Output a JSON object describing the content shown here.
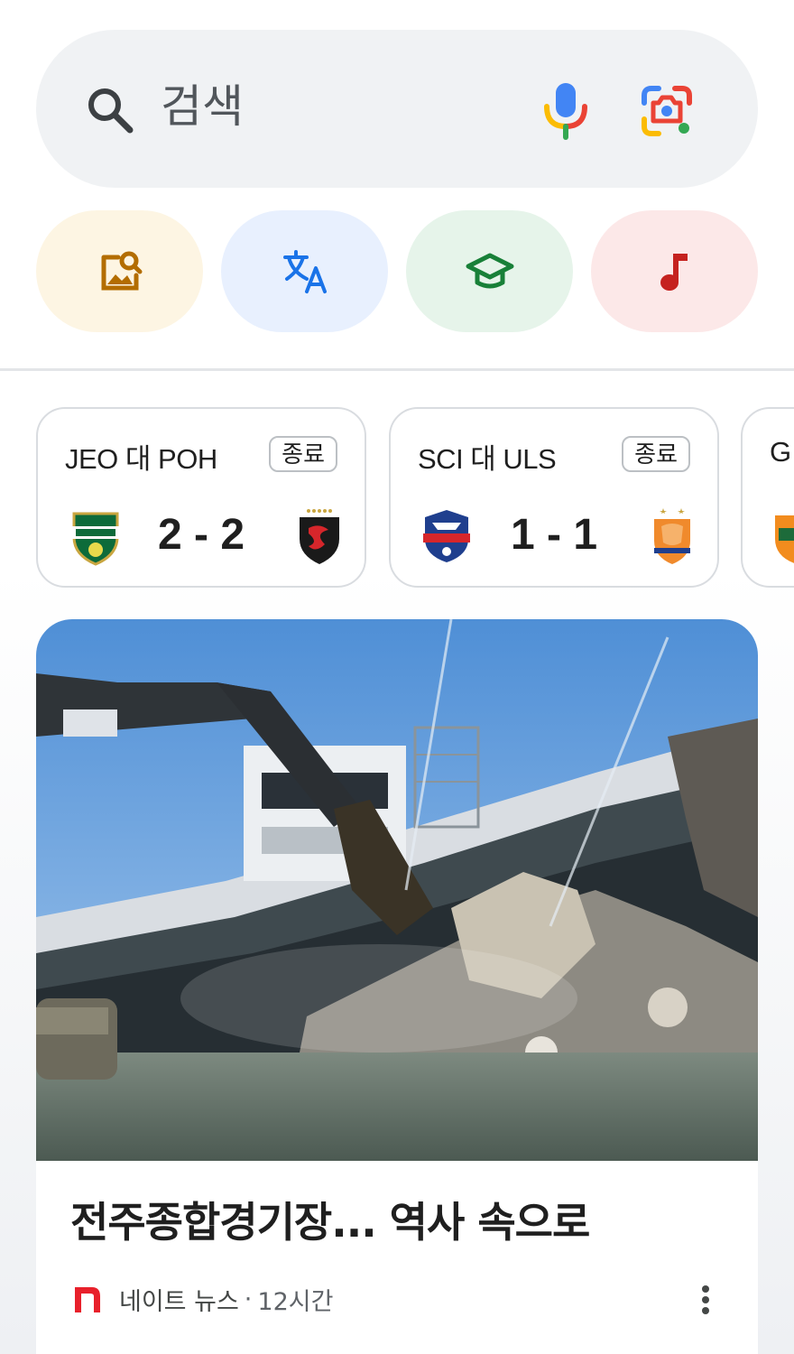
{
  "search": {
    "placeholder": "검색",
    "icons": [
      "search-icon",
      "microphone-icon",
      "google-lens-icon"
    ]
  },
  "shortcuts": [
    {
      "name": "image-search",
      "icon": "image-search-icon",
      "bg": "#fdf5e3",
      "color": "#b36d00"
    },
    {
      "name": "translate",
      "icon": "translate-icon",
      "bg": "#e8f0fe",
      "color": "#1a73e8"
    },
    {
      "name": "education",
      "icon": "graduation-cap-icon",
      "bg": "#e6f4ea",
      "color": "#188038"
    },
    {
      "name": "music",
      "icon": "music-note-icon",
      "bg": "#fce8e8",
      "color": "#c5221f"
    }
  ],
  "matches": [
    {
      "title": "JEO 대 POH",
      "status": "종료",
      "score": "2 - 2",
      "home_logo": "jeonbuk-logo",
      "away_logo": "pohang-logo"
    },
    {
      "title": "SCI 대 ULS",
      "status": "종료",
      "score": "1 - 1",
      "home_logo": "suwon-fc-logo",
      "away_logo": "ulsan-hyundai-logo"
    },
    {
      "title": "G"
    }
  ],
  "news": {
    "headline": "전주종합경기장... 역사 속으로",
    "source": "네이트 뉴스",
    "separator": "·",
    "time": "12시간"
  },
  "colors": {
    "search_bg": "#f0f2f4",
    "card_border": "#d9dce0",
    "source_red": "#e8202b"
  }
}
